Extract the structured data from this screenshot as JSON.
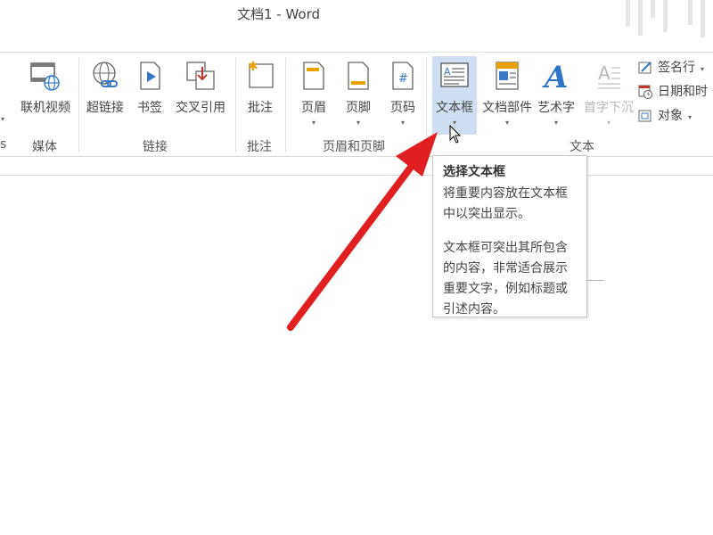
{
  "window": {
    "title": "文档1 - Word"
  },
  "ribbon": {
    "commands": {
      "online_video": "联机视频",
      "hyperlink": "超链接",
      "bookmark": "书签",
      "cross_reference": "交叉引用",
      "comment": "批注",
      "header": "页眉",
      "footer": "页脚",
      "page_number": "页码",
      "text_box": "文本框",
      "quick_parts": "文档部件",
      "wordart": "艺术字",
      "drop_cap": "首字下沉",
      "signature_line": "签名行",
      "date_time": "日期和时",
      "object": "对象"
    },
    "groups": {
      "media": "媒体",
      "links": "链接",
      "comments": "批注",
      "header_footer": "页眉和页脚",
      "text": "文本"
    }
  },
  "tooltip": {
    "title": "选择文本框",
    "line1": "将重要内容放在文本框",
    "line2": "中以突出显示。",
    "line3": "文本框可突出其所包含",
    "line4": "的内容，非常适合展示",
    "line5": "重要文字，例如标题或",
    "line6": "引述内容。"
  },
  "colors": {
    "accent_arrow": "#e02020",
    "active_button": "#cfdff1",
    "wordart_blue": "#2e75c8"
  }
}
